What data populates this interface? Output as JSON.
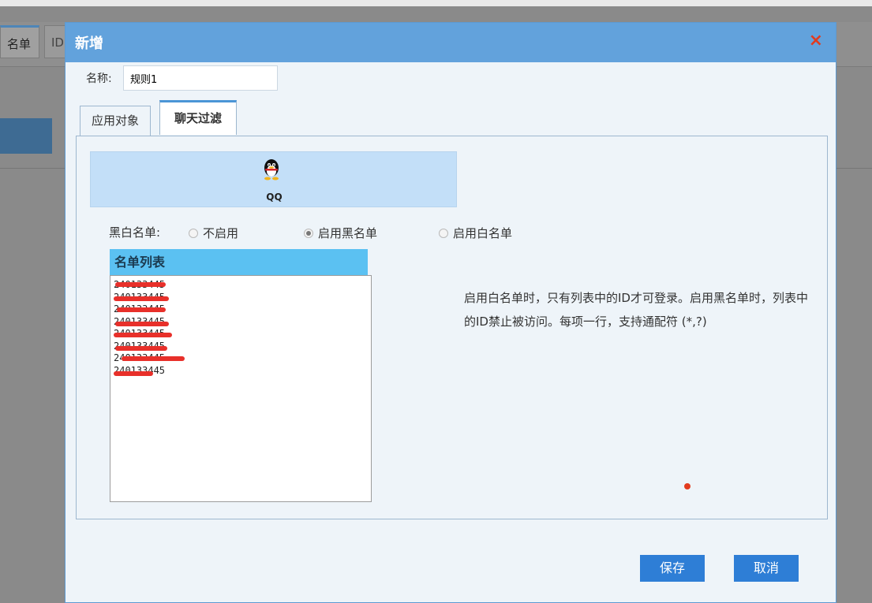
{
  "background": {
    "tabs": [
      "名单",
      "ID"
    ]
  },
  "dialog": {
    "title": "新增",
    "close_glyph": "×",
    "name_label": "名称:",
    "name_value": "规则1",
    "tabs": [
      {
        "label": "应用对象",
        "active": false
      },
      {
        "label": "聊天过滤",
        "active": true
      }
    ],
    "app": {
      "label": "QQ",
      "icon": "qq-penguin-icon"
    },
    "bw_label": "黑白名单:",
    "radios": [
      {
        "label": "不启用",
        "checked": false
      },
      {
        "label": "启用黑名单",
        "checked": true
      },
      {
        "label": "启用白名单",
        "checked": false
      }
    ],
    "list_title": "名单列表",
    "list_items": [
      "240133445",
      "240133445",
      "240133445",
      "240133445",
      "240133445",
      "240133445",
      "240133445",
      "240133445"
    ],
    "hint": "启用白名单时，只有列表中的ID才可登录。启用黑名单时，列表中的ID禁止被访问。每项一行，支持通配符 (*,?)",
    "buttons": {
      "save": "保存",
      "cancel": "取消"
    }
  },
  "colors": {
    "header": "#62a2dc",
    "list_header": "#5bc1f2",
    "button": "#2e7ed6",
    "redaction": "#e8302a"
  }
}
